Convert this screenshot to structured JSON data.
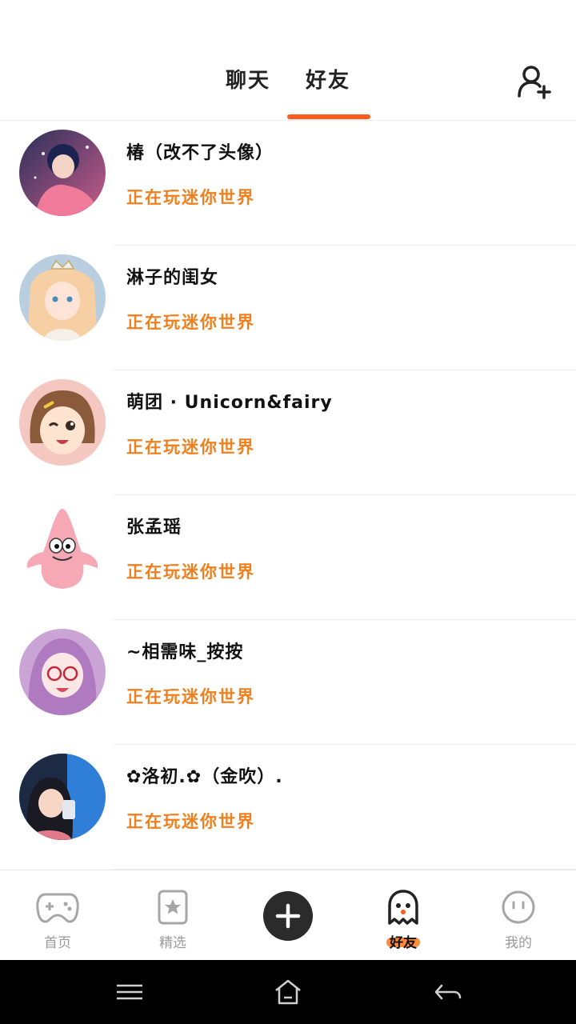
{
  "header": {
    "tabs": [
      {
        "label": "聊天",
        "active": false
      },
      {
        "label": "好友",
        "active": true
      }
    ],
    "add_friend_icon": "add-user-icon",
    "accent_color": "#ff5a1f"
  },
  "friends": [
    {
      "name": "椿（改不了头像）",
      "status": "正在玩迷你世界"
    },
    {
      "name": "淋子的闺女",
      "status": "正在玩迷你世界"
    },
    {
      "name": "萌团 · Unicorn&fairy",
      "status": "正在玩迷你世界"
    },
    {
      "name": "张孟瑶",
      "status": "正在玩迷你世界"
    },
    {
      "name": "~相需味_按按",
      "status": "正在玩迷你世界"
    },
    {
      "name": "✿洛初.✿（金吹）.",
      "status": "正在玩迷你世界"
    }
  ],
  "status_color": "#f07f1e",
  "bottom_nav": [
    {
      "label": "首页",
      "icon": "gamepad-icon",
      "active": false
    },
    {
      "label": "精选",
      "icon": "star-bookmark-icon",
      "active": false
    },
    {
      "label": "",
      "icon": "plus-icon",
      "active": false
    },
    {
      "label": "好友",
      "icon": "ghost-icon",
      "active": true
    },
    {
      "label": "我的",
      "icon": "face-icon",
      "active": false
    }
  ],
  "system_nav": [
    "menu-icon",
    "home-icon",
    "back-icon"
  ]
}
